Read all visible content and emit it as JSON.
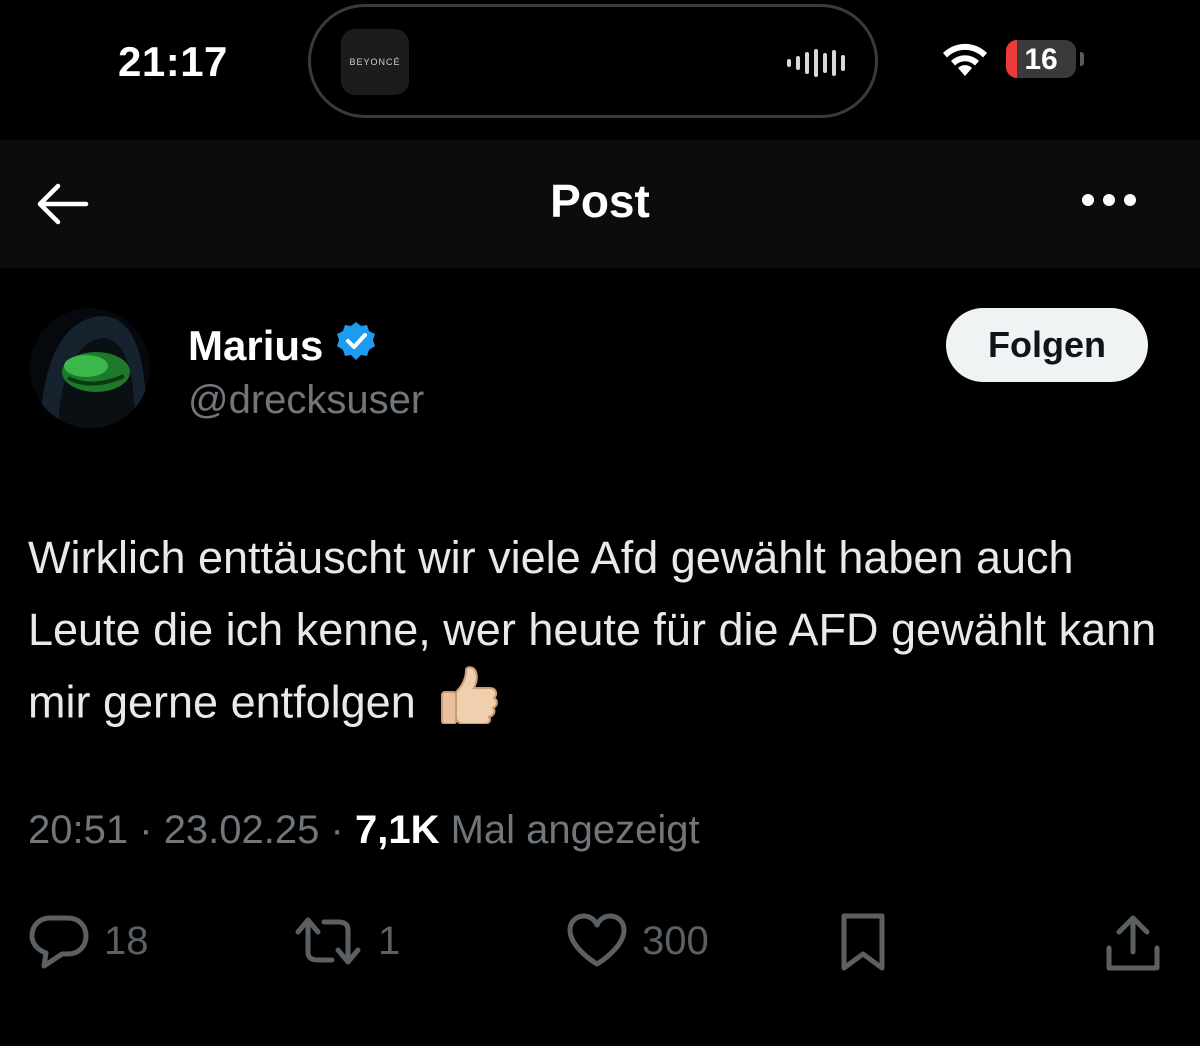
{
  "status_bar": {
    "time": "21:17",
    "now_playing_label": "BEYONCÉ",
    "battery_level": "16",
    "battery_fraction": 0.16
  },
  "header": {
    "title": "Post",
    "back_icon": "arrow-left-icon",
    "more_icon": "more-horizontal-icon"
  },
  "author": {
    "name": "Marius",
    "handle": "@drecksuser",
    "verified": true,
    "follow_label": "Folgen"
  },
  "tweet": {
    "text": "Wirklich enttäuscht wir viele Afd gewählt haben auch Leute die ich kenne, wer heute für die AFD gewählt kann mir gerne entfolgen",
    "emoji": "thumbs-up-icon"
  },
  "meta": {
    "time": "20:51",
    "separator": "·",
    "date": "23.02.25",
    "views": "7,1K",
    "views_label": "Mal angezeigt"
  },
  "actions": {
    "replies": "18",
    "reposts": "1",
    "likes": "300"
  },
  "colors": {
    "background": "#000000",
    "text": "#e7e9ea",
    "muted": "#71767b",
    "verified": "#1d9bf0",
    "battery_low": "#eb3b3b"
  }
}
